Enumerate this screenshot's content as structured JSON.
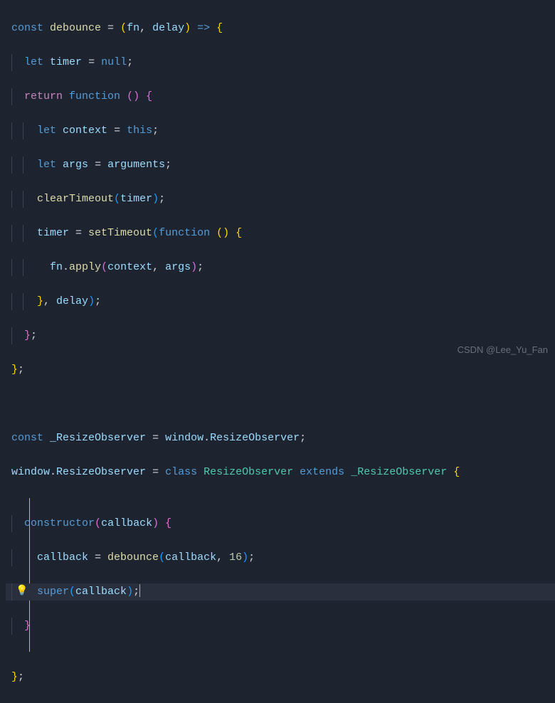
{
  "code": {
    "l1": {
      "const": "const",
      "name": "debounce",
      "eq": " = ",
      "p1": "(",
      "fn": "fn",
      "comma": ", ",
      "delay": "delay",
      "p2": ")",
      "arrow": " => ",
      "brace": "{"
    },
    "l2": {
      "let": "let",
      "timer": "timer",
      "eq": " = ",
      "null": "null",
      "semi": ";"
    },
    "l3": {
      "return": "return",
      "function": "function",
      "parens": "()",
      "brace": " {"
    },
    "l4": {
      "let": "let",
      "context": "context",
      "eq": " = ",
      "this": "this",
      "semi": ";"
    },
    "l5": {
      "let": "let",
      "args": "args",
      "eq": " = ",
      "arguments": "arguments",
      "semi": ";"
    },
    "l6": {
      "fn": "clearTimeout",
      "p1": "(",
      "timer": "timer",
      "p2": ")",
      "semi": ";"
    },
    "l7": {
      "timer": "timer",
      "eq": " = ",
      "fn": "setTimeout",
      "p1": "(",
      "function": "function",
      "parens": " ()",
      "brace": " {"
    },
    "l8": {
      "fn": "fn",
      "dot": ".",
      "apply": "apply",
      "p1": "(",
      "context": "context",
      "comma": ", ",
      "args": "args",
      "p2": ")",
      "semi": ";"
    },
    "l9": {
      "brace": "}",
      "comma": ", ",
      "delay": "delay",
      "p2": ")",
      "semi": ";"
    },
    "l10": {
      "brace": "}",
      "semi": ";"
    },
    "l11": {
      "brace": "}",
      "semi": ";"
    },
    "l12": "",
    "l13": {
      "const": "const",
      "name": "_ResizeObserver",
      "eq": " = ",
      "window": "window",
      "dot": ".",
      "prop": "ResizeObserver",
      "semi": ";"
    },
    "l14": {
      "window": "window",
      "dot": ".",
      "prop": "ResizeObserver",
      "eq": " = ",
      "class": "class",
      "name": "ResizeObserver",
      "extends": "extends",
      "base": "_ResizeObserver",
      "brace": " {"
    },
    "l15": {
      "constructor": "constructor",
      "p1": "(",
      "callback": "callback",
      "p2": ")",
      "brace": " {"
    },
    "l16": {
      "callback": "callback",
      "eq": " = ",
      "fn": "debounce",
      "p1": "(",
      "arg1": "callback",
      "comma": ", ",
      "num": "16",
      "p2": ")",
      "semi": ";"
    },
    "l17": {
      "super": "super",
      "p1": "(",
      "callback": "callback",
      "p2": ")",
      "semi": ";"
    },
    "l18": {
      "brace": "}"
    },
    "l19": {
      "brace": "}",
      "semi": ";"
    }
  },
  "lightbulb": "💡",
  "watermark": "CSDN @Lee_Yu_Fan"
}
